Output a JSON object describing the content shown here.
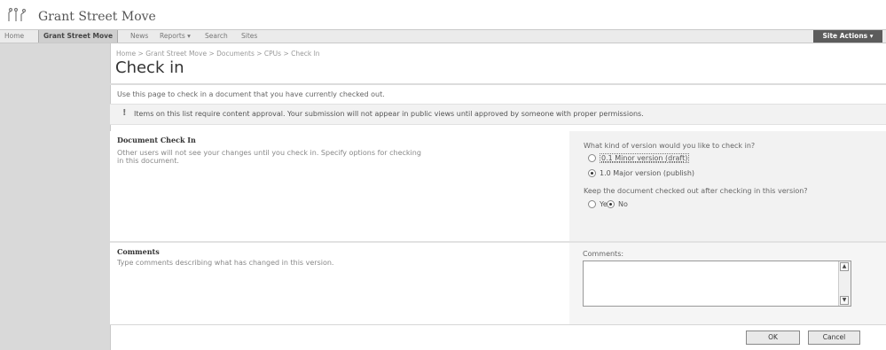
{
  "site": {
    "title": "Grant Street Move",
    "logo_icon": "sharepoint-logo-icon"
  },
  "topnav": {
    "items": [
      "Home",
      "Grant Street Move",
      "News",
      "Reports ▾",
      "Search",
      "Sites"
    ],
    "site_actions": "Site Actions ▾"
  },
  "page": {
    "breadcrumb": "Home > Grant Street Move > Documents > CPUs > Check In",
    "title": "Check in",
    "intro": "Use this page to check in a document that you have currently checked out.",
    "notice_icon": "!",
    "notice": "Items on this list require content approval. Your submission will not appear in public views until approved by someone with proper permissions."
  },
  "checkin_section": {
    "heading": "Document Check In",
    "description": "Other users will not see your changes until you check in. Specify options for checking in this document.",
    "version_question": "What kind of version would you like to check in?",
    "version_options": [
      "0.1 Minor version (draft)",
      "1.0 Major version (publish)"
    ],
    "selected_version": "1.0 Major version (publish)",
    "keep_question": "Keep the document checked out after checking in this version?",
    "keep_options": [
      "Yes",
      "No"
    ],
    "selected_keep": "No"
  },
  "comments_section": {
    "heading": "Comments",
    "description": "Type comments describing what has changed in this version.",
    "field_label": "Comments:",
    "value": ""
  },
  "buttons": {
    "ok": "OK",
    "cancel": "Cancel"
  }
}
